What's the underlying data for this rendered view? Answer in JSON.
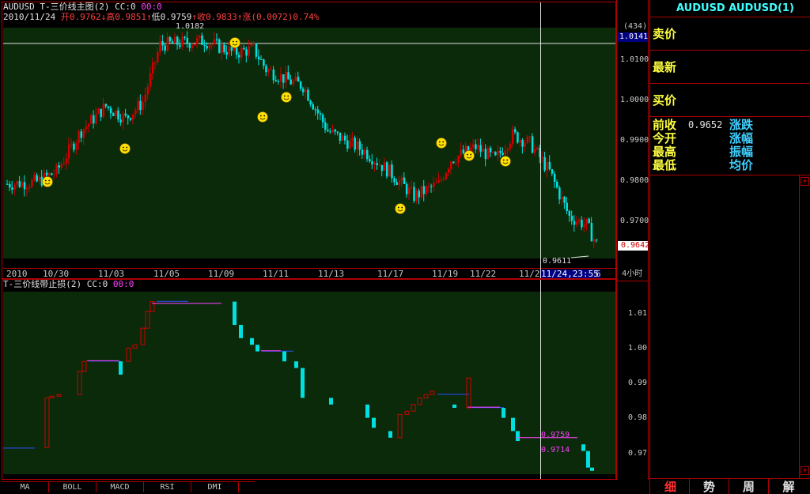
{
  "main_chart": {
    "title": "AUDUSD T-三价线主图(2)",
    "cc_label": "CC:0",
    "cc_value": "00:0",
    "ohlc": {
      "date": "2010/11/24",
      "open_label": "开",
      "open": "0.9762",
      "high_label": "高",
      "high": "0.9851",
      "low_label": "低",
      "low": "0.9759",
      "close_label": "收",
      "close": "0.9833",
      "change_label": "涨",
      "change": "(0.0072)",
      "change_pct": "0.74%"
    },
    "peak_label": "1.0182",
    "low_marker_label": "0.9611",
    "y_count": "(434)",
    "y_cross_value": "1.0141",
    "y_current_value": "0.9642",
    "y_ticks": [
      "1.0100",
      "1.0000",
      "0.9900",
      "0.9800",
      "0.9700"
    ],
    "x_dates": [
      "2010",
      "10/30",
      "11/03",
      "11/05",
      "11/09",
      "11/11",
      "11/13",
      "11/17",
      "11/19",
      "11/22",
      "11/2"
    ],
    "x_cursor_date": "11/24,23:55",
    "x_cursor_tail": "6",
    "period": "4小时"
  },
  "sub_chart": {
    "title": "T-三价线带止损(2)",
    "cc_label": "CC:0",
    "cc_value": "00:0",
    "y_ticks": [
      "1.01",
      "1.00",
      "0.99",
      "0.98",
      "0.97"
    ],
    "label_a": "0.9759",
    "label_b": "0.9714"
  },
  "right_panel": {
    "symbol_title": "AUDUSD AUDUSD(1)",
    "sell_label": "卖价",
    "latest_label": "最新",
    "buy_label": "买价",
    "prev_close_label": "前收",
    "prev_close_value": "0.9652",
    "change_label": "涨跌",
    "open_label": "今开",
    "change_pct_label": "涨幅",
    "high_label": "最高",
    "amplitude_label": "振幅",
    "low_label": "最低",
    "avg_label": "均价"
  },
  "indicator_tabs": [
    "MA",
    "BOLL",
    "MACD",
    "RSI",
    "DMI"
  ],
  "bottom_tabs": [
    "细",
    "势",
    "周",
    "解"
  ],
  "colors": {
    "up_candle": "#d00000",
    "down_candle": "#00e0e0",
    "grid_bg": "#0a2a0a",
    "border": "#b00000",
    "symbol_title": "#40ffff",
    "quote_label": "#ffff40"
  },
  "chart_data": {
    "type": "line",
    "title": "AUDUSD T-三价线主图(2)",
    "x": [
      "10/30",
      "11/03",
      "11/05",
      "11/09",
      "11/11",
      "11/13",
      "11/17",
      "11/19",
      "11/22",
      "11/24"
    ],
    "series": [
      {
        "values": [
          0.981,
          0.999,
          1.014,
          1.01,
          0.998,
          0.985,
          0.976,
          0.99,
          0.987,
          0.9642
        ]
      }
    ],
    "ylim": [
      0.962,
      1.018
    ]
  }
}
